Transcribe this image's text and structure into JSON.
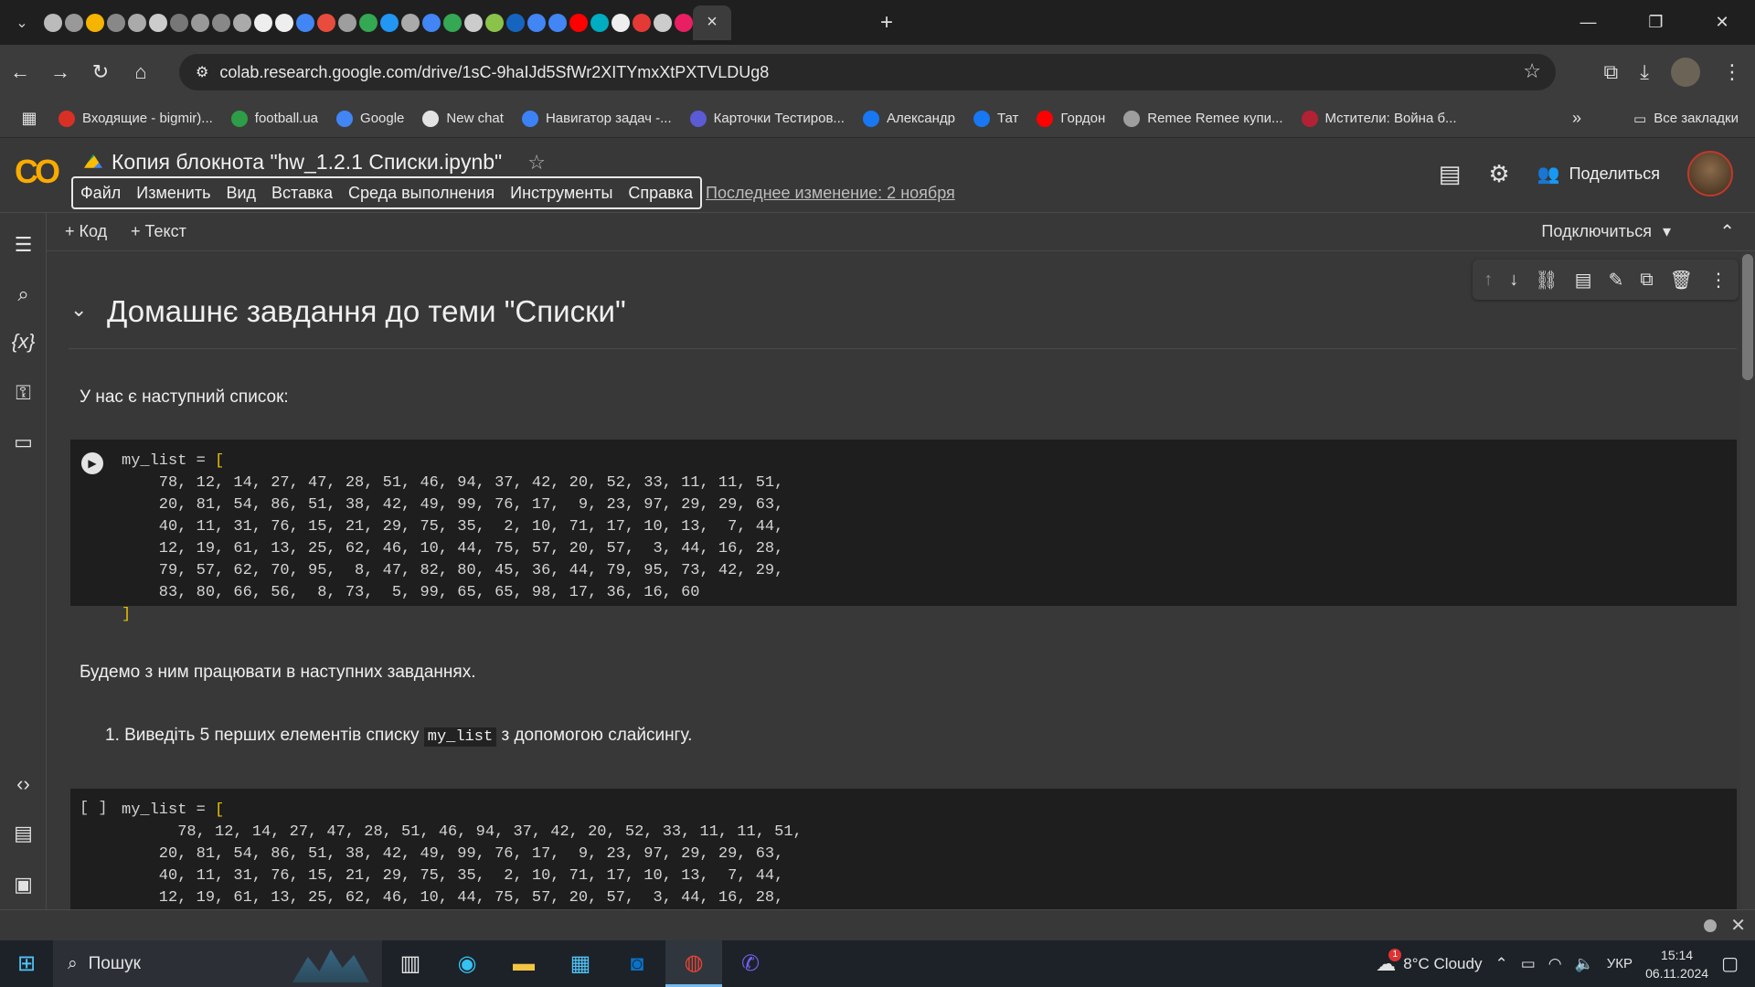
{
  "browser": {
    "active_tab_close": "×",
    "new_tab": "+",
    "url": "colab.research.google.com/drive/1sC-9haIJd5SfWr2XITYmxXtPXTVLDUg8"
  },
  "bookmarks": {
    "items": [
      {
        "label": "Входящие - bigmir)...",
        "color": "#d93025"
      },
      {
        "label": "football.ua",
        "color": "#2e9d47"
      },
      {
        "label": "Google",
        "color": "#4285f4"
      },
      {
        "label": "New chat",
        "color": "#e3e3e3"
      },
      {
        "label": "Навигатор задач -...",
        "color": "#3b82f6"
      },
      {
        "label": "Карточки Тестиров...",
        "color": "#5b5bd6"
      },
      {
        "label": "Александр",
        "color": "#1877f2"
      },
      {
        "label": "Тат",
        "color": "#1877f2"
      },
      {
        "label": "Гордон",
        "color": "#ff0000"
      },
      {
        "label": "Remee Remee купи...",
        "color": "#9e9e9e"
      },
      {
        "label": "Мстители: Война б...",
        "color": "#b22234"
      }
    ],
    "more": "»",
    "all_bookmarks": "Все закладки"
  },
  "colab": {
    "logo": "CO",
    "title": "Копия блокнота \"hw_1.2.1 Списки.ipynb\"",
    "menu": [
      "Файл",
      "Изменить",
      "Вид",
      "Вставка",
      "Среда выполнения",
      "Инструменты",
      "Справка"
    ],
    "last_modified": "Последнее изменение: 2 ноября",
    "share": "Поделиться",
    "add_code": "+ Код",
    "add_text": "+ Текст",
    "connect": "Подключиться"
  },
  "notebook": {
    "heading": "Домашнє завдання до теми \"Списки\"",
    "intro": "У нас є наступний список:",
    "code1": {
      "head": "my_list = ",
      "open": "[",
      "rows": "    78, 12, 14, 27, 47, 28, 51, 46, 94, 37, 42, 20, 52, 33, 11, 11, 51,\n    20, 81, 54, 86, 51, 38, 42, 49, 99, 76, 17,  9, 23, 97, 29, 29, 63,\n    40, 11, 31, 76, 15, 21, 29, 75, 35,  2, 10, 71, 17, 10, 13,  7, 44,\n    12, 19, 61, 13, 25, 62, 46, 10, 44, 75, 57, 20, 57,  3, 44, 16, 28,\n    79, 57, 62, 70, 95,  8, 47, 82, 80, 45, 36, 44, 79, 95, 73, 42, 29,\n    83, 80, 66, 56,  8, 73,  5, 99, 65, 65, 98, 17, 36, 16, 60",
      "close": "]"
    },
    "followup": "Будемо з ним працювати в наступних завданнях.",
    "task1_pre": "1. Виведіть 5 перших елементів списку ",
    "task1_code": "my_list",
    "task1_post": " з допомогою слайсингу.",
    "code2": {
      "prompt": "[ ]",
      "head": "my_list = ",
      "open": "[",
      "rows": "      78, 12, 14, 27, 47, 28, 51, 46, 94, 37, 42, 20, 52, 33, 11, 11, 51,\n    20, 81, 54, 86, 51, 38, 42, 49, 99, 76, 17,  9, 23, 97, 29, 29, 63,\n    40, 11, 31, 76, 15, 21, 29, 75, 35,  2, 10, 71, 17, 10, 13,  7, 44,\n    12, 19, 61, 13, 25, 62, 46, 10, 44, 75, 57, 20, 57,  3, 44, 16, 28,"
    }
  },
  "taskbar": {
    "search": "Пошук",
    "weather": "8°C  Cloudy",
    "weather_badge": "1",
    "lang": "УКР",
    "time": "15:14",
    "date": "06.11.2024"
  }
}
